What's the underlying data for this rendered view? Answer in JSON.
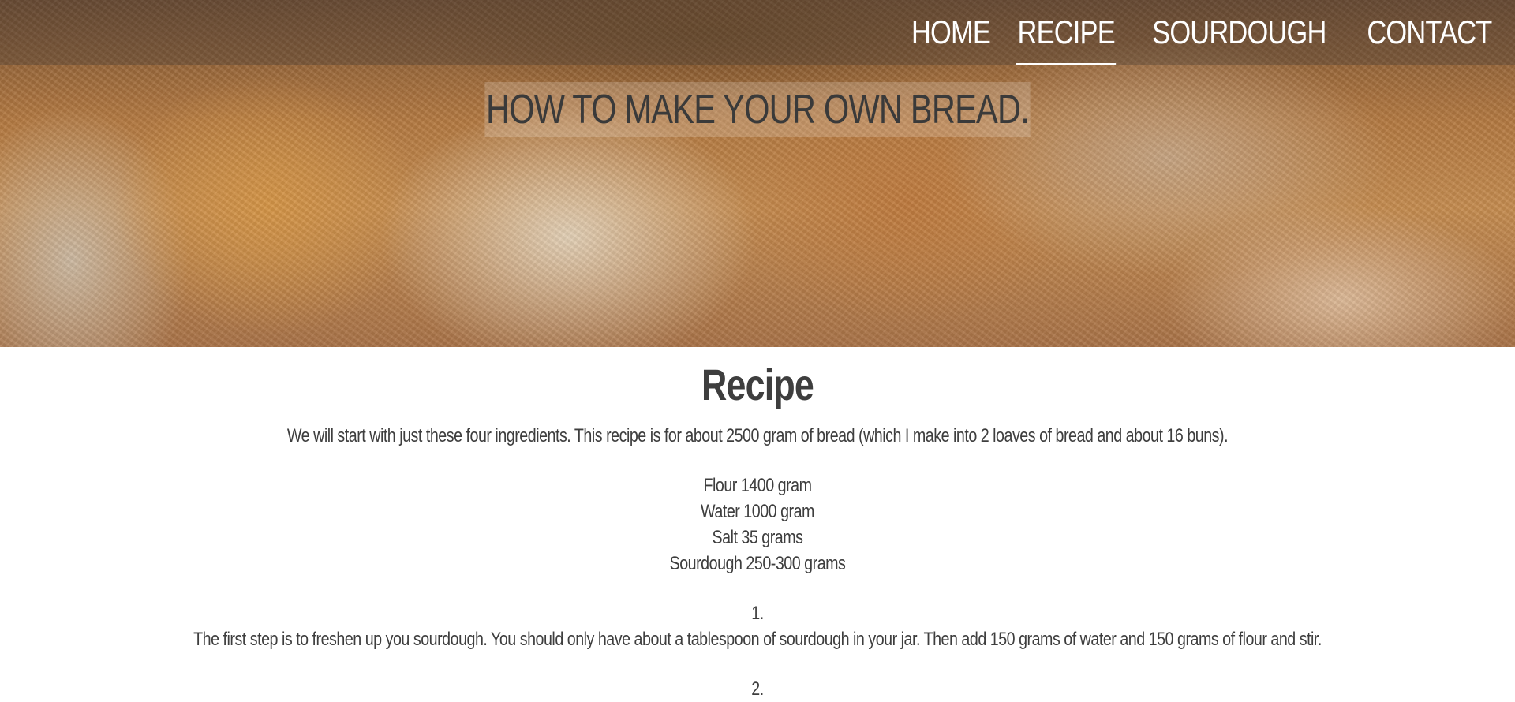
{
  "nav": {
    "items": [
      {
        "label": "HOME"
      },
      {
        "label": "RECIPE"
      },
      {
        "label": "SOURDOUGH"
      },
      {
        "label": "CONTACT"
      }
    ],
    "active": "RECIPE"
  },
  "hero": {
    "title": "HOW TO MAKE YOUR OWN BREAD."
  },
  "recipe": {
    "title": "Recipe",
    "intro": "We will start with just these four ingredients. This recipe is for about 2500 gram of bread (which I make into 2 loaves of bread and about 16 buns).",
    "ingredients": [
      "Flour 1400 gram",
      "Water 1000 gram",
      "Salt 35 grams",
      "Sourdough 250-300 grams"
    ],
    "steps": [
      {
        "number": "1.",
        "text": "The first step is to freshen up you sourdough. You should only have about a tablespoon of sourdough in your jar. Then add 150 grams of water and 150 grams of flour and stir."
      },
      {
        "number": "2.",
        "text": ""
      }
    ]
  },
  "colors": {
    "text": "#3e3e3e",
    "nav_text": "#ffffff",
    "background": "#ffffff"
  }
}
